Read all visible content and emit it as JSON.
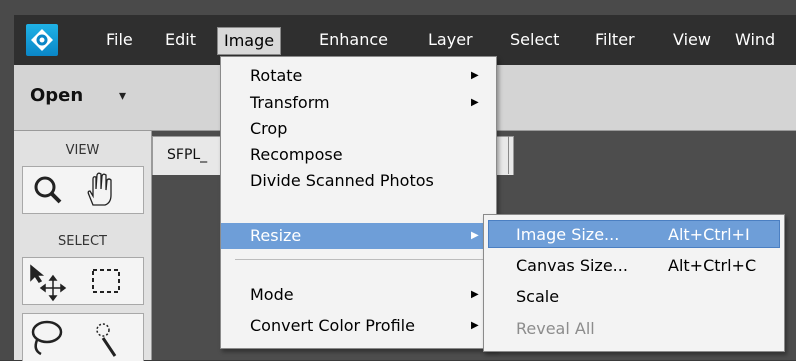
{
  "menubar": {
    "items": [
      "File",
      "Edit",
      "Image",
      "Enhance",
      "Layer",
      "Select",
      "Filter",
      "View",
      "Wind"
    ]
  },
  "optionbar": {
    "open_label": "Open",
    "open_arrow": "▾"
  },
  "leftpanel": {
    "view_label": "VIEW",
    "select_label": "SELECT"
  },
  "document": {
    "tab_label": "SFPL_"
  },
  "image_menu": {
    "items": [
      {
        "label": "Rotate",
        "arrow": "▶"
      },
      {
        "label": "Transform",
        "arrow": "▶"
      },
      {
        "label": "Crop"
      },
      {
        "label": "Recompose"
      },
      {
        "label": "Divide Scanned Photos"
      },
      {
        "label": "Resize",
        "arrow": "▶"
      },
      {
        "label": "Mode",
        "arrow": "▶"
      },
      {
        "label": "Convert Color Profile",
        "arrow": "▶"
      }
    ]
  },
  "resize_submenu": {
    "items": [
      {
        "label": "Image Size...",
        "shortcut": "Alt+Ctrl+I"
      },
      {
        "label": "Canvas Size...",
        "shortcut": "Alt+Ctrl+C"
      },
      {
        "label": "Scale"
      },
      {
        "label": "Reveal All"
      }
    ]
  },
  "colors": {
    "highlight": "#6e9ed8",
    "menubar": "#2f2f2f",
    "logo": "#1fb2e6"
  },
  "icons": [
    "app-logo-icon",
    "zoom-icon",
    "hand-icon",
    "move-icon",
    "marquee-icon",
    "lasso-icon",
    "quick-selection-icon"
  ]
}
